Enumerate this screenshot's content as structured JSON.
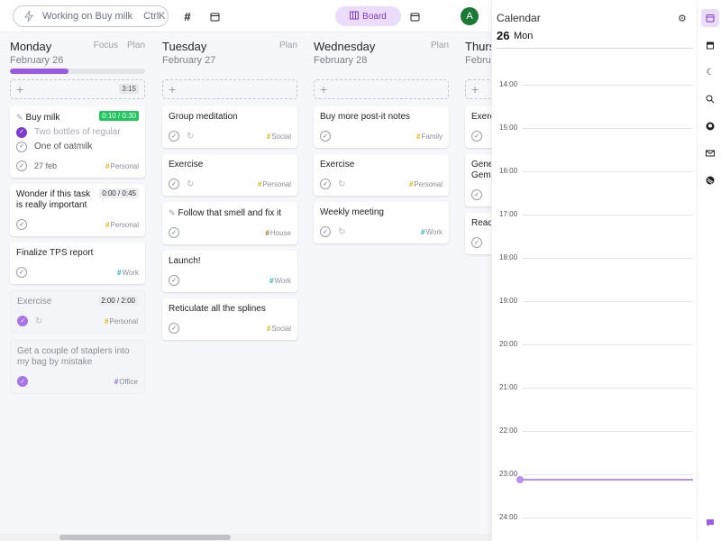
{
  "topbar": {
    "focus_text": "Working on Buy milk",
    "shortcut": "CtrlK",
    "view_board_label": "Board",
    "avatar_initial": "A"
  },
  "board": {
    "columns": [
      {
        "day": "Monday",
        "date": "February 26",
        "focus_label": "Focus",
        "plan_label": "Plan",
        "progress": 0.43,
        "add_duration": "3:15",
        "cards": [
          {
            "title": "Buy milk",
            "timer": "0:10 / 0:30",
            "subtasks": [
              {
                "text": "Two bottles of regular",
                "done": true
              },
              {
                "text": "One of oatmilk",
                "done": false
              }
            ],
            "date": "27 feb",
            "tag": "Personal",
            "tag_color": "#eab308"
          },
          {
            "title": "Wonder if this task is really important",
            "timer": "0:00 / 0:45",
            "tag": "Personal",
            "tag_color": "#eab308"
          },
          {
            "title": "Finalize TPS report",
            "tag": "Work",
            "tag_color": "#14b8a6"
          },
          {
            "title": "Exercise",
            "timer": "2:00 / 2:00",
            "tag": "Personal",
            "tag_color": "#eab308",
            "done": true
          },
          {
            "title": "Get a couple of staplers into my bag by mistake",
            "tag": "Office",
            "tag_color": "#8b5cf6",
            "done": true
          }
        ]
      },
      {
        "day": "Tuesday",
        "date": "February 27",
        "plan_label": "Plan",
        "cards": [
          {
            "title": "Group meditation",
            "tag": "Social",
            "tag_color": "#eab308",
            "repeat": true
          },
          {
            "title": "Exercise",
            "tag": "Personal",
            "tag_color": "#eab308",
            "repeat": true
          },
          {
            "title": "Follow that smell and fix it",
            "tag": "House",
            "tag_color": "#a16207"
          },
          {
            "title": "Launch!",
            "tag": "Work",
            "tag_color": "#14b8a6"
          },
          {
            "title": "Reticulate all the splines",
            "tag": "Social",
            "tag_color": "#eab308"
          }
        ]
      },
      {
        "day": "Wednesday",
        "date": "February 28",
        "plan_label": "Plan",
        "cards": [
          {
            "title": "Buy more post-it notes",
            "tag": "Family",
            "tag_color": "#eab308"
          },
          {
            "title": "Exercise",
            "tag": "Personal",
            "tag_color": "#eab308",
            "repeat": true
          },
          {
            "title": "Weekly meeting",
            "tag": "Work",
            "tag_color": "#14b8a6",
            "repeat": true
          }
        ]
      },
      {
        "day": "Thurs",
        "date": "Febru",
        "cards": [
          {
            "title": "Exerc"
          },
          {
            "title": "Gene Gemi"
          },
          {
            "title": "Read"
          }
        ]
      }
    ]
  },
  "calendar": {
    "title": "Calendar",
    "day_number": "26",
    "day_name": "Mon",
    "hours": [
      "14:00",
      "15:00",
      "16:00",
      "17:00",
      "18:00",
      "19:00",
      "20:00",
      "21:00",
      "22:00",
      "23:00",
      "24:00"
    ]
  },
  "rail": {
    "items": [
      "calendar-icon",
      "archive-icon",
      "moon-icon",
      "search-icon",
      "github-icon",
      "mail-icon",
      "stack-icon",
      "chat-icon"
    ]
  },
  "colors": {
    "accent": "#9b5ae6",
    "accent_bg": "#ecdcfb",
    "timer_active": "#22c55e"
  }
}
